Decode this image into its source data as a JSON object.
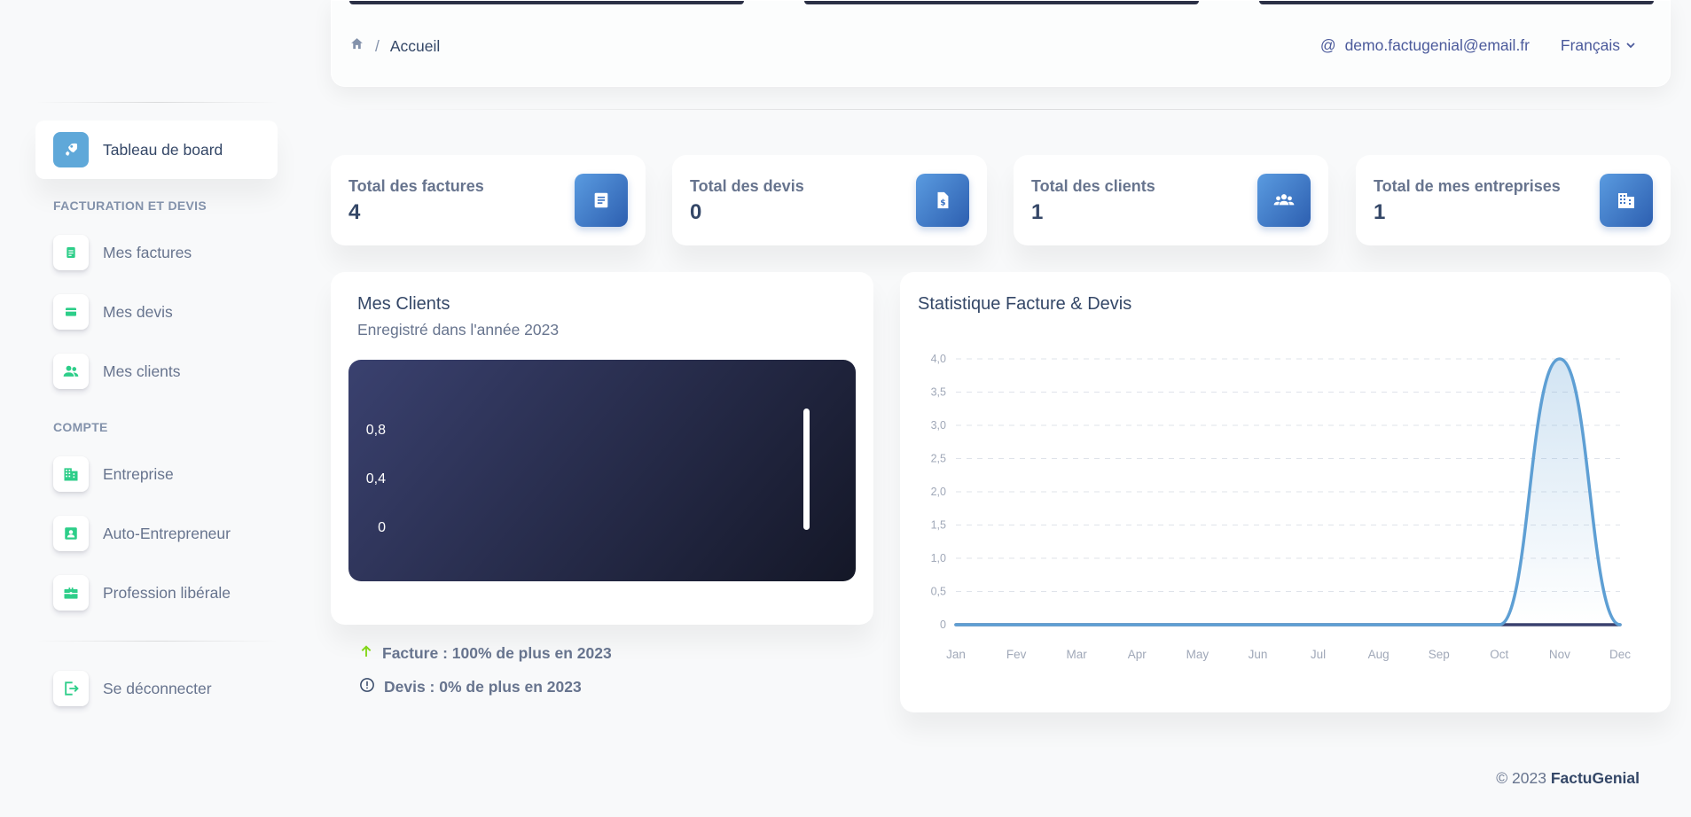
{
  "sidebar": {
    "active_item": {
      "label": "Tableau de board",
      "icon": "rocket-icon"
    },
    "sections": [
      {
        "title": "Facturation et devis",
        "items": [
          {
            "label": "Mes factures",
            "icon": "invoice-icon"
          },
          {
            "label": "Mes devis",
            "icon": "card-icon"
          },
          {
            "label": "Mes clients",
            "icon": "users-icon"
          }
        ]
      },
      {
        "title": "Compte",
        "items": [
          {
            "label": "Entreprise",
            "icon": "building-icon"
          },
          {
            "label": "Auto-Entrepreneur",
            "icon": "id-badge-icon"
          },
          {
            "label": "Profession libérale",
            "icon": "briefcase-icon"
          }
        ]
      }
    ],
    "logout_label": "Se déconnecter",
    "accent_color": "#2dce89"
  },
  "navbar": {
    "breadcrumb_current": "Accueil",
    "breadcrumb_separator": "/",
    "user_email": "demo.factugenial@email.fr",
    "user_prefix": "@",
    "language": "Français"
  },
  "stats": [
    {
      "label": "Total des factures",
      "value": "4",
      "icon": "document-icon"
    },
    {
      "label": "Total des devis",
      "value": "0",
      "icon": "file-dollar-icon"
    },
    {
      "label": "Total des clients",
      "value": "1",
      "icon": "group-icon"
    },
    {
      "label": "Total de mes entreprises",
      "value": "1",
      "icon": "building-icon"
    }
  ],
  "clients_card": {
    "title": "Mes Clients",
    "subtitle": "Enregistré dans l'année 2023",
    "y_ticks": [
      "0,8",
      "0,4",
      "0"
    ],
    "legend": [
      {
        "text": "Facture : 100% de plus en 2023",
        "icon": "arrow-up-icon",
        "color": "#82d616"
      },
      {
        "text": "Devis : 0% de plus en 2023",
        "icon": "info-circle-icon",
        "color": "#344767"
      }
    ]
  },
  "chart_card": {
    "title": "Statistique Facture & Devis"
  },
  "chart_data": {
    "type": "line",
    "title": "Statistique Facture & Devis",
    "x": [
      "Jan",
      "Fev",
      "Mar",
      "Apr",
      "May",
      "Jun",
      "Jul",
      "Aug",
      "Sep",
      "Oct",
      "Nov",
      "Dec"
    ],
    "y_ticks": [
      "0",
      "0,5",
      "1,0",
      "1,5",
      "2,0",
      "2,5",
      "3,0",
      "3,5",
      "4,0"
    ],
    "ylim": [
      0,
      4
    ],
    "grid": true,
    "series": [
      {
        "values": [
          0,
          0,
          0,
          0,
          0,
          0,
          0,
          0,
          0,
          0,
          4,
          0
        ],
        "color": "#5e9fd4"
      },
      {
        "values": [
          0,
          0,
          0,
          0,
          0,
          0,
          0,
          0,
          0,
          0,
          0,
          0
        ],
        "color": "#3a416f"
      }
    ]
  },
  "footer": {
    "copyright": "© 2023",
    "brand": "FactuGenial"
  }
}
